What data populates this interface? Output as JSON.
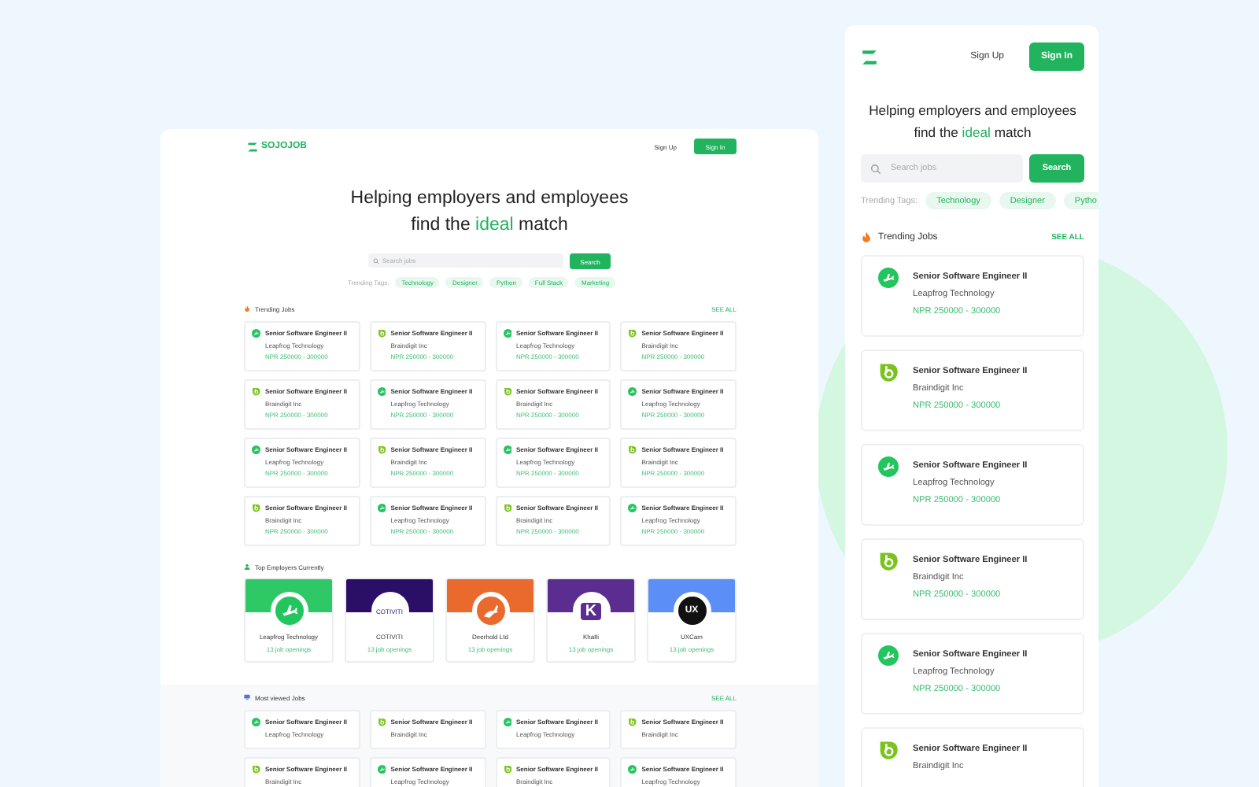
{
  "desktop": {
    "logo_text": "SOJOJOB",
    "nav": {
      "sign_up": "Sign Up",
      "sign_in": "Sign In"
    },
    "headline": {
      "line_1": "Helping employers and employees",
      "line_2_before": "find the",
      "highlight": "ideal",
      "line_2_after": "match"
    },
    "search": {
      "placeholder": "Search jobs",
      "button": "Search"
    },
    "trending_tags": {
      "label": "Trending Tags:",
      "tags": [
        "Technology",
        "Designer",
        "Python",
        "Full Stack",
        "Marketing"
      ]
    },
    "trending_jobs": {
      "title": "Trending Jobs",
      "see_all": "SEE ALL",
      "jobs": [
        {
          "kind": "plane",
          "title": "Senior Software Engineer II",
          "company": "Leapfrog Technology",
          "salary": "NPR 250000 - 300000"
        },
        {
          "kind": "leaf",
          "title": "Senior Software Engineer II",
          "company": "Braindigit Inc",
          "salary": "NPR 250000 - 300000"
        },
        {
          "kind": "plane",
          "title": "Senior Software Engineer II",
          "company": "Leapfrog Technology",
          "salary": "NPR 250000 - 300000"
        },
        {
          "kind": "leaf",
          "title": "Senior Software Engineer II",
          "company": "Braindigit Inc",
          "salary": "NPR 250000 - 300000"
        },
        {
          "kind": "leaf",
          "title": "Senior Software Engineer II",
          "company": "Braindigit Inc",
          "salary": "NPR 250000 - 300000"
        },
        {
          "kind": "plane",
          "title": "Senior Software Engineer II",
          "company": "Leapfrog Technology",
          "salary": "NPR 250000 - 300000"
        },
        {
          "kind": "leaf",
          "title": "Senior Software Engineer II",
          "company": "Braindigit Inc",
          "salary": "NPR 250000 - 300000"
        },
        {
          "kind": "plane",
          "title": "Senior Software Engineer II",
          "company": "Leapfrog Technology",
          "salary": "NPR 250000 - 300000"
        },
        {
          "kind": "plane",
          "title": "Senior Software Engineer II",
          "company": "Leapfrog Technology",
          "salary": "NPR 250000 - 300000"
        },
        {
          "kind": "leaf",
          "title": "Senior Software Engineer II",
          "company": "Braindigit Inc",
          "salary": "NPR 250000 - 300000"
        },
        {
          "kind": "plane",
          "title": "Senior Software Engineer II",
          "company": "Leapfrog Technology",
          "salary": "NPR 250000 - 300000"
        },
        {
          "kind": "leaf",
          "title": "Senior Software Engineer II",
          "company": "Braindigit Inc",
          "salary": "NPR 250000 - 300000"
        },
        {
          "kind": "leaf",
          "title": "Senior Software Engineer II",
          "company": "Braindigit Inc",
          "salary": "NPR 250000 - 300000"
        },
        {
          "kind": "plane",
          "title": "Senior Software Engineer II",
          "company": "Leapfrog Technology",
          "salary": "NPR 250000 - 300000"
        },
        {
          "kind": "leaf",
          "title": "Senior Software Engineer II",
          "company": "Braindigit Inc",
          "salary": "NPR 250000 - 300000"
        },
        {
          "kind": "plane",
          "title": "Senior Software Engineer II",
          "company": "Leapfrog Technology",
          "salary": "NPR 250000 - 300000"
        }
      ]
    },
    "top_employers": {
      "title": "Top Employers Currently",
      "employers": [
        {
          "kind": "plane",
          "name": "Leapfrog Technology",
          "openings": "13 job openings",
          "color": "#2ec866"
        },
        {
          "kind": "wordmark",
          "logo_text": "COTIVITI",
          "name": "COTIVITI",
          "openings": "13 job openings",
          "color": "#2b0f66"
        },
        {
          "kind": "deer",
          "name": "Deerhold Ltd",
          "openings": "13 job openings",
          "color": "#ea6a2e"
        },
        {
          "kind": "letter",
          "logo_text": "K",
          "name": "Khalti",
          "openings": "13 job openings",
          "color": "#5c2d91"
        },
        {
          "kind": "dark",
          "logo_text": "UX",
          "name": "UXCam",
          "openings": "13 job openings",
          "color": "#5b8ef7"
        }
      ]
    },
    "most_viewed": {
      "title": "Most viewed Jobs",
      "see_all": "SEE ALL",
      "jobs": [
        {
          "kind": "plane",
          "title": "Senior Software Engineer II",
          "company": "Leapfrog Technology"
        },
        {
          "kind": "leaf",
          "title": "Senior Software Engineer II",
          "company": "Braindigit Inc"
        },
        {
          "kind": "plane",
          "title": "Senior Software Engineer II",
          "company": "Leapfrog Technology"
        },
        {
          "kind": "leaf",
          "title": "Senior Software Engineer II",
          "company": "Braindigit Inc"
        },
        {
          "kind": "leaf",
          "title": "Senior Software Engineer II",
          "company": "Braindigit Inc"
        },
        {
          "kind": "plane",
          "title": "Senior Software Engineer II",
          "company": "Leapfrog Technology"
        },
        {
          "kind": "leaf",
          "title": "Senior Software Engineer II",
          "company": "Braindigit Inc"
        },
        {
          "kind": "plane",
          "title": "Senior Software Engineer II",
          "company": "Leapfrog Technology"
        }
      ]
    }
  },
  "mobile": {
    "nav": {
      "sign_up": "Sign Up",
      "sign_in": "Sign In"
    },
    "headline": {
      "line_1": "Helping employers and employees",
      "line_2_before": "find the",
      "highlight": "ideal",
      "line_2_after": "match"
    },
    "search": {
      "placeholder": "Search jobs",
      "button": "Search"
    },
    "trending_tags": {
      "label": "Trending Tags:",
      "tags": [
        "Technology",
        "Designer",
        "Pytho"
      ]
    },
    "trending_jobs": {
      "title": "Trending Jobs",
      "see_all": "SEE ALL",
      "jobs": [
        {
          "kind": "plane",
          "title": "Senior Software Engineer II",
          "company": "Leapfrog Technology",
          "salary": "NPR 250000 - 300000"
        },
        {
          "kind": "leaf",
          "title": "Senior Software Engineer II",
          "company": "Braindigit Inc",
          "salary": "NPR 250000 - 300000"
        },
        {
          "kind": "plane",
          "title": "Senior Software Engineer II",
          "company": "Leapfrog Technology",
          "salary": "NPR 250000 - 300000"
        },
        {
          "kind": "leaf",
          "title": "Senior Software Engineer II",
          "company": "Braindigit Inc",
          "salary": "NPR 250000 - 300000"
        },
        {
          "kind": "plane",
          "title": "Senior Software Engineer II",
          "company": "Leapfrog Technology",
          "salary": "NPR 250000 - 300000"
        },
        {
          "kind": "leaf",
          "title": "Senior Software Engineer II",
          "company": "Braindigit Inc"
        }
      ]
    }
  }
}
